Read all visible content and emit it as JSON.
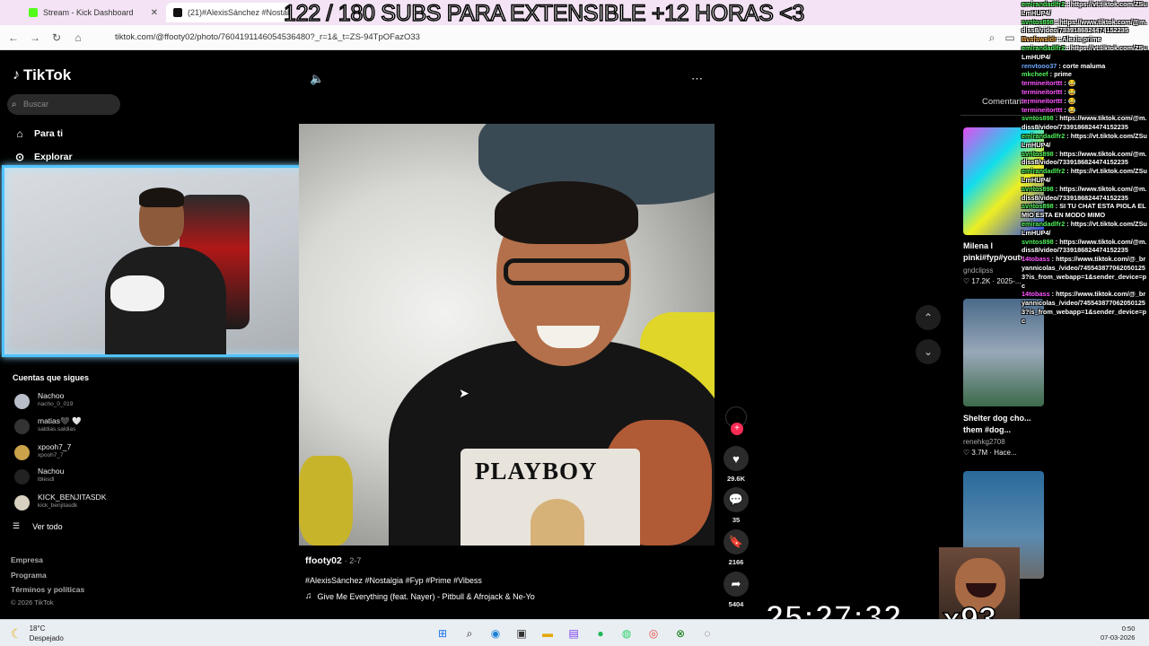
{
  "browser": {
    "tabs": [
      {
        "label": "Stream - Kick Dashboard",
        "close": "✕"
      },
      {
        "label": "(21)#AlexisSánchez #Nostalgia"
      }
    ],
    "url": "tiktok.com/@ffooty02/photo/7604191146054536480?_r=1&_t=ZS-94TpOFazO33"
  },
  "overlay": {
    "subs_goal": "122 / 180 SUBS PARA EXTENSIBLE +12 HORAS <3",
    "timer": "25:27:32",
    "multiplier": "x93"
  },
  "sidebar": {
    "logo": "TikTok",
    "search_placeholder": "Buscar",
    "nav": [
      {
        "label": "Para ti"
      },
      {
        "label": "Explorar"
      }
    ],
    "following_header": "Cuentas que sigues",
    "accounts": [
      {
        "name": "Nachoo",
        "handle": "nacho_0_019",
        "color": "#b8bec8"
      },
      {
        "name": "matias🖤 🤍",
        "handle": "saldias.saldias",
        "color": "#333333"
      },
      {
        "name": "xpooh7_7",
        "handle": "xpooh7_7",
        "color": "#caa24a"
      },
      {
        "name": "Nachou",
        "handle": "lblesdl",
        "color": "#222222"
      },
      {
        "name": "KICK_BENJITASDK",
        "handle": "kick_benjitasdk",
        "color": "#d8d0c0"
      }
    ],
    "see_all": "Ver todo",
    "footer": [
      "Empresa",
      "Programa",
      "Términos y políticas"
    ],
    "copyright": "© 2026 TikTok"
  },
  "post": {
    "creator": "ffooty02",
    "date": "· 2-7",
    "hashtags": "#AlexisSánchez #Nostalgia #Fyp #Prime #Vibess",
    "music": "Give Me Everything (feat. Nayer) - Pitbull & Afrojack & Ne-Yo",
    "shirt_text": "PLAYBOY",
    "likes": "29.6K",
    "comments": "35",
    "saves": "2166",
    "shares": "5404"
  },
  "right": {
    "comments_tab": "Comentarios",
    "videos": [
      {
        "title": "Milena l pinki#fyp#youtu...",
        "author": "gndclipss",
        "stats": "♡ 17.2K · 2025-..."
      },
      {
        "title": "Shelter dog cho... them #dog...",
        "author": "renehkg2708",
        "stats": "♡ 3.7M · Hace..."
      }
    ]
  },
  "chat": [
    {
      "user": "emirandadlfr2",
      "cls": "",
      "msg": "https://vt.tiktok.com/ZSuLmHUP4/"
    },
    {
      "user": "svntos898",
      "cls": "",
      "msg": "https://www.tiktok.com/@m.diss8/video/7339186824474152235"
    },
    {
      "user": "Bvsfswsldr",
      "cls": "o",
      "msg": "Alexis prime"
    },
    {
      "user": "emirandadlfr2",
      "cls": "",
      "msg": "https://vt.tiktok.com/ZSuLmHUP4/"
    },
    {
      "user": "renvtooo37",
      "cls": "b",
      "msg": "corte maluma"
    },
    {
      "user": "mkcheef",
      "cls": "",
      "msg": "prime"
    },
    {
      "user": "termineitorttt",
      "cls": "p",
      "msg": "😂"
    },
    {
      "user": "termineitorttt",
      "cls": "p",
      "msg": "😂"
    },
    {
      "user": "termineitorttt",
      "cls": "p",
      "msg": "😂"
    },
    {
      "user": "termineitorttt",
      "cls": "p",
      "msg": "😂"
    },
    {
      "user": "svntos898",
      "cls": "",
      "msg": "https://www.tiktok.com/@m.diss8/video/7339186824474152235"
    },
    {
      "user": "emirandadlfr2",
      "cls": "",
      "msg": "https://vt.tiktok.com/ZSuLmHUP4/"
    },
    {
      "user": "svntos898",
      "cls": "",
      "msg": "https://www.tiktok.com/@m.diss8/video/7339186824474152235"
    },
    {
      "user": "emirandadlfr2",
      "cls": "",
      "msg": "https://vt.tiktok.com/ZSuLmHUP4/"
    },
    {
      "user": "svntos898",
      "cls": "",
      "msg": "https://www.tiktok.com/@m.diss8/video/7339186824474152235"
    },
    {
      "user": "svntos898",
      "cls": "",
      "msg": "SI TU CHAT ESTA PIOLA EL MIO ESTA EN MODO MIMO"
    },
    {
      "user": "emirandadlfr2",
      "cls": "",
      "msg": "https://vt.tiktok.com/ZSuLmHUP4/"
    },
    {
      "user": "svntos898",
      "cls": "",
      "msg": "https://www.tiktok.com/@m.diss8/video/7339186824474152235"
    },
    {
      "user": "14tobass",
      "cls": "p",
      "msg": "https://www.tiktok.com/@_bryannicolas_/video/7455438770620501253?is_from_webapp=1&sender_device=pc"
    },
    {
      "user": "14tobass",
      "cls": "p",
      "msg": "https://www.tiktok.com/@_bryannicolas_/video/7455438770620501253?is_from_webapp=1&sender_device=pc"
    }
  ],
  "taskbar": {
    "temp": "18°C",
    "condition": "Despejado",
    "time": "0:50",
    "date": "07-03-2026"
  }
}
